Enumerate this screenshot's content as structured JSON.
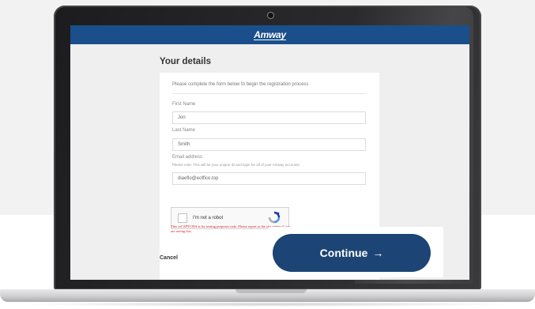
{
  "header": {
    "logo_text": "Amway",
    "bar_color": "#1a4f8b"
  },
  "page": {
    "title": "Your details"
  },
  "form": {
    "intro": "Please complete the form below to begin the registration process",
    "first_name": {
      "label": "First Name",
      "value": "Jon"
    },
    "last_name": {
      "label": "Last Name",
      "value": "Smith"
    },
    "email": {
      "label": "Email address",
      "hint": "Please note: This will be your unique ID and login for all of your Amway accounts",
      "value": "diaeflo@eoffice.top"
    },
    "recaptcha": {
      "label": "I'm not a robot",
      "warning": "This reCAPTCHA is for testing purposes only. Please report to the site admin if you are seeing this."
    }
  },
  "actions": {
    "cancel_label": "Cancel",
    "continue_label": "Continue",
    "continue_arrow": "→",
    "continue_color": "#1c4474"
  }
}
